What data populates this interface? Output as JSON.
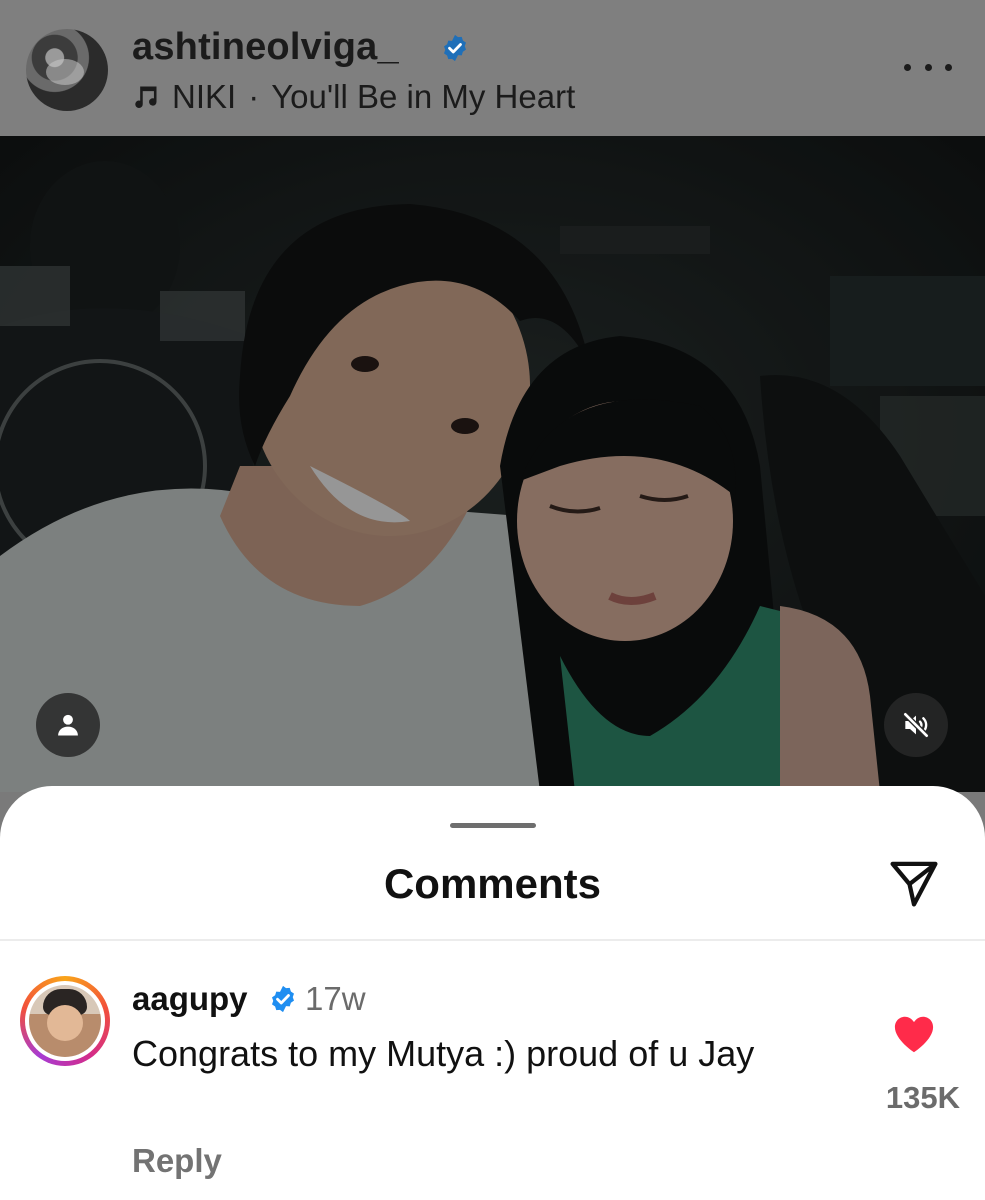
{
  "post": {
    "username": "ashtineolviga_",
    "verified": true,
    "music": {
      "artist": "NIKI",
      "separator": "·",
      "song": "You'll Be in My Heart"
    }
  },
  "media": {
    "description_icons": [
      "person-tag-icon",
      "speaker-muted-icon"
    ]
  },
  "comments_sheet": {
    "title": "Comments",
    "comments": [
      {
        "username": "aagupy",
        "verified": true,
        "time": "17w",
        "text": "Congrats to my Mutya :) proud of u Jay",
        "likes": "135K",
        "liked": true,
        "reply_label": "Reply"
      }
    ]
  },
  "colors": {
    "verified_blue": "#1f8ef1",
    "heart_red": "#ff2b4a",
    "dim_overlay": "#7f7f7f"
  }
}
